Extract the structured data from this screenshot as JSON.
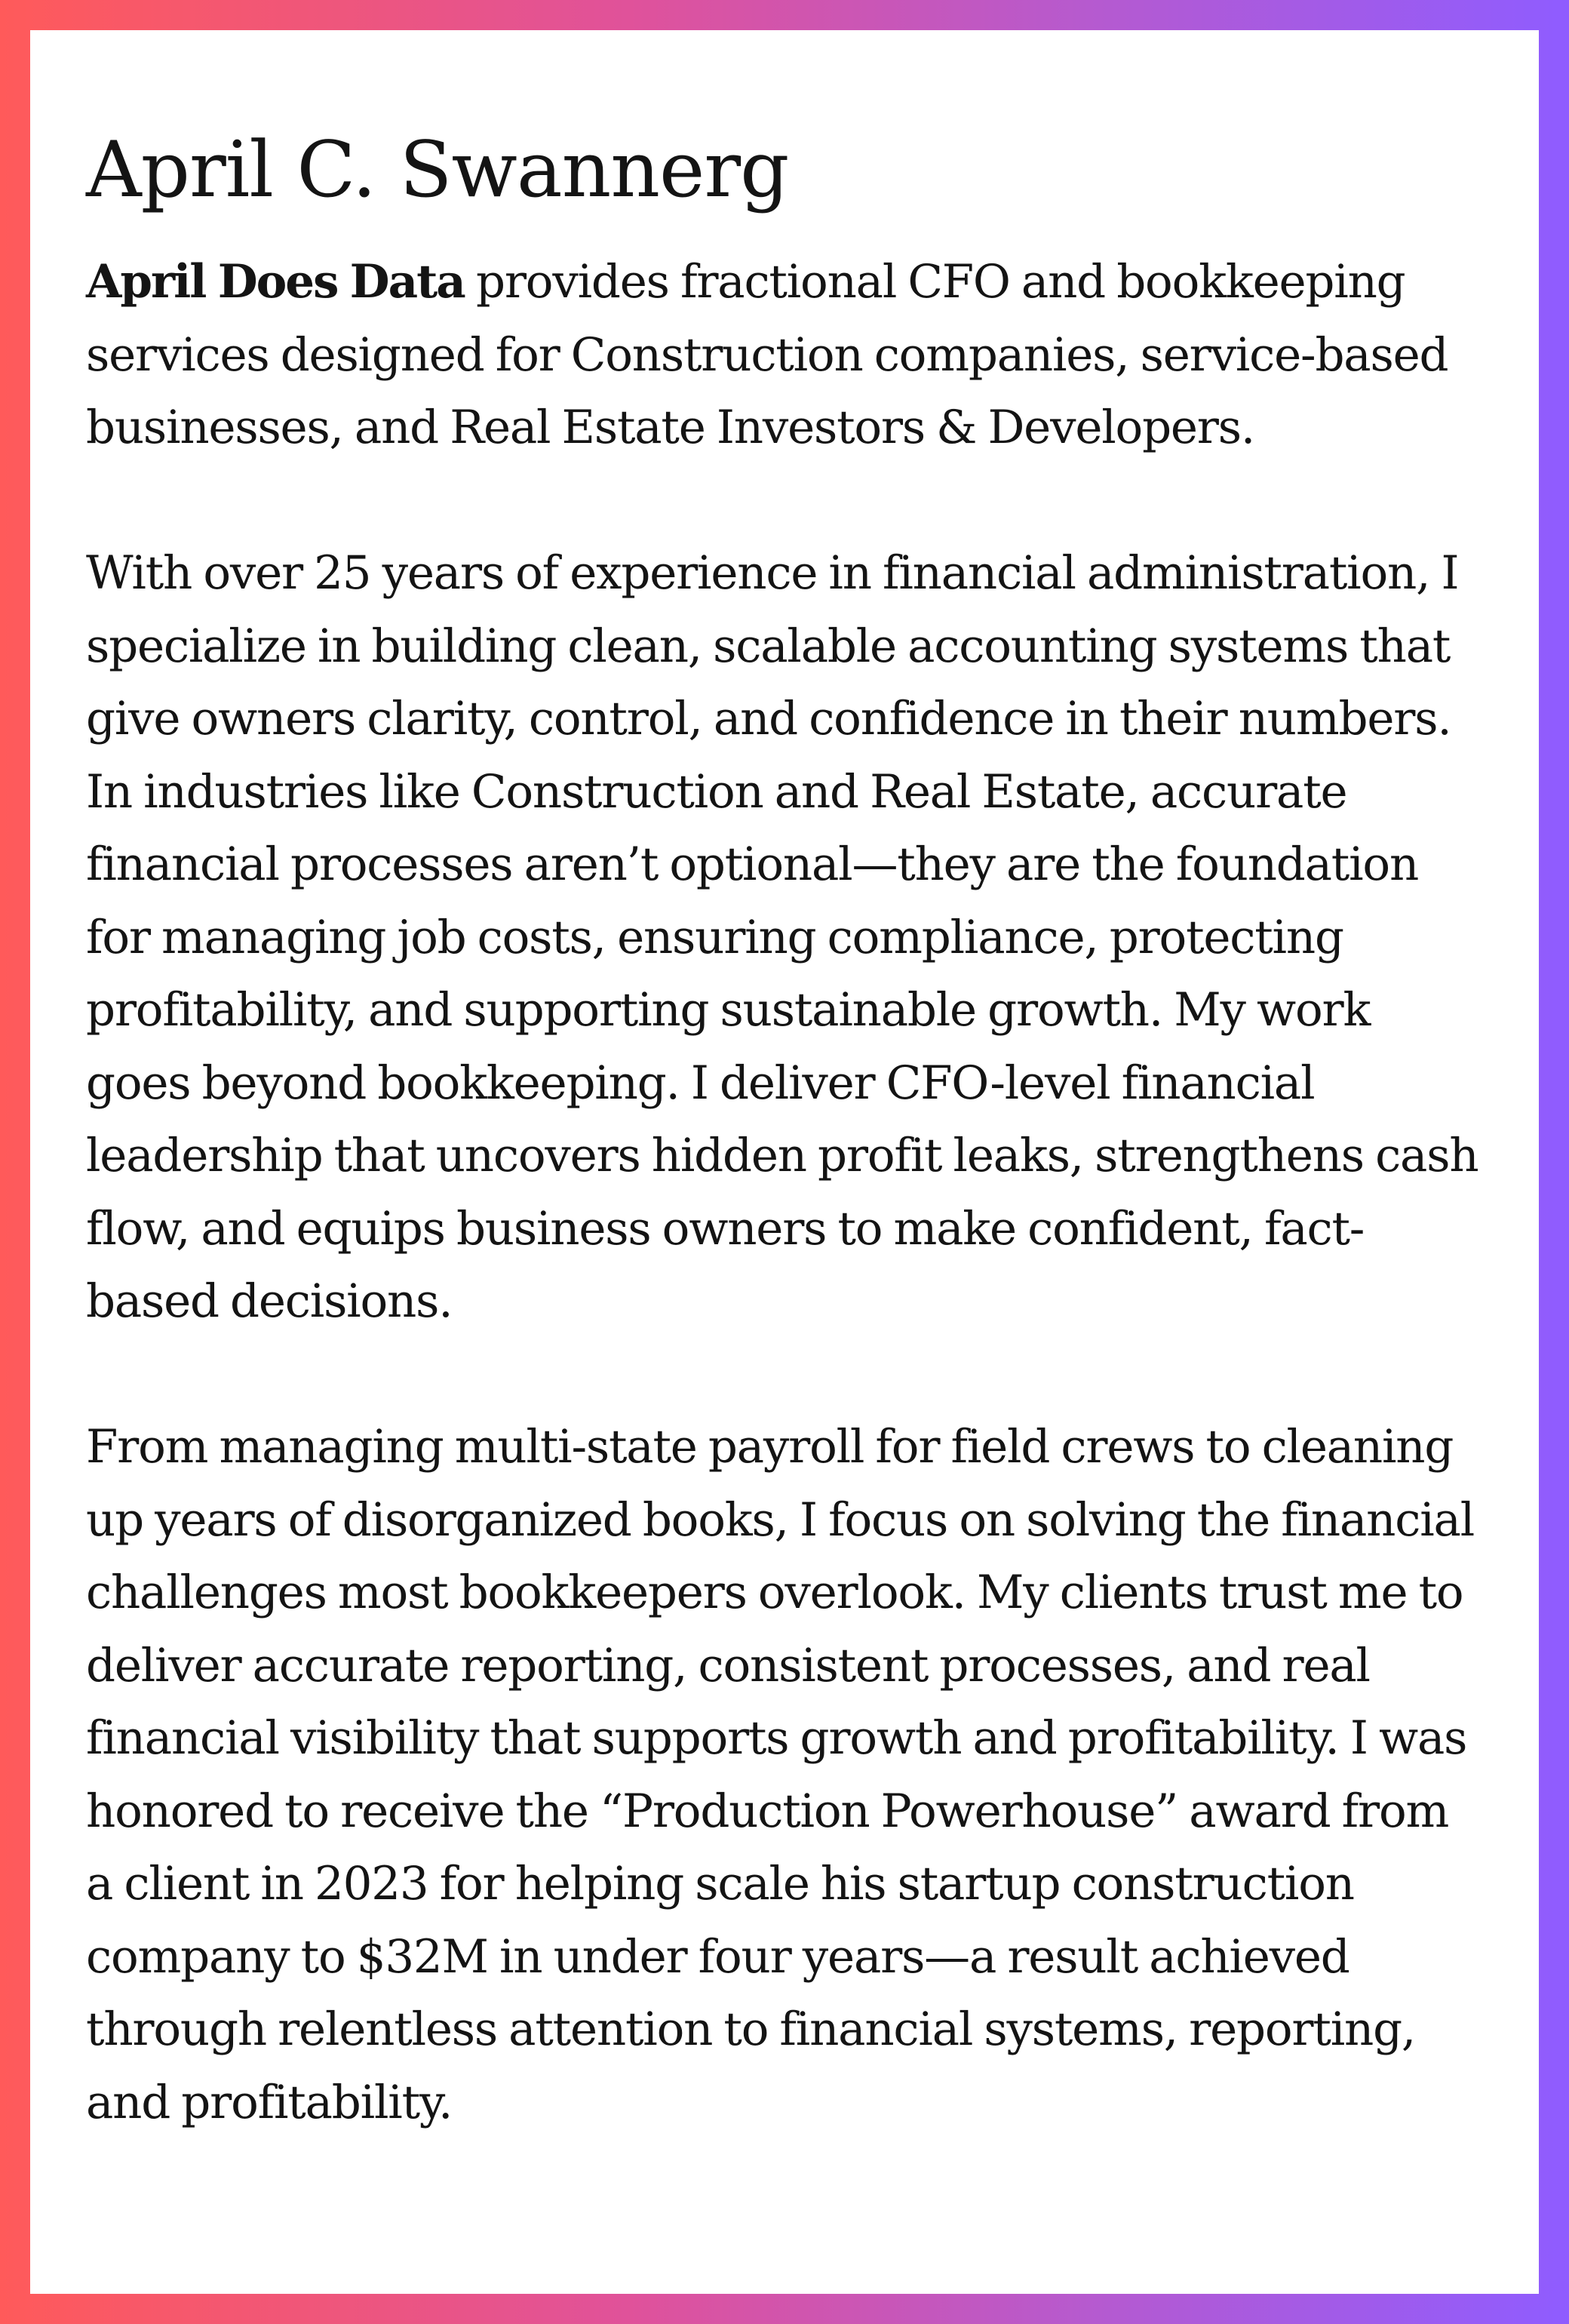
{
  "profile": {
    "name": "April C. Swannerg",
    "brand": "April Does Data",
    "intro_rest": " provides fractional CFO and bookkeeping services designed for Construction companies, service-based businesses, and Real Estate Investors & Developers.",
    "paragraph_2": "With over 25 years of experience in financial administration, I specialize in building clean, scalable accounting systems that give owners clarity, control, and confidence in their numbers. In industries like Construction and Real Estate, accurate financial processes aren’t optional—they are the foundation for managing job costs, ensuring compliance, protecting profitability, and supporting sustainable growth. My work goes beyond bookkeeping. I deliver CFO-level financial leadership that uncovers hidden profit leaks, strengthens cash flow, and equips business owners to make confident, fact-based decisions.",
    "paragraph_3": "From managing multi-state payroll for field crews to cleaning up years of disorganized books, I focus on solving the financial challenges most bookkeepers overlook. My clients trust me to deliver accurate reporting, consistent processes, and real financial visibility that supports growth and profitability. I was honored to receive the “Production Powerhouse” award from a client in 2023 for helping scale his startup construction company to $32M in under four years—a result achieved through relentless attention to financial systems, reporting, and profitability."
  },
  "colors": {
    "gradient_left": "#ff5a5a",
    "gradient_right": "#8f5cff",
    "text": "#141414",
    "card": "#ffffff"
  }
}
